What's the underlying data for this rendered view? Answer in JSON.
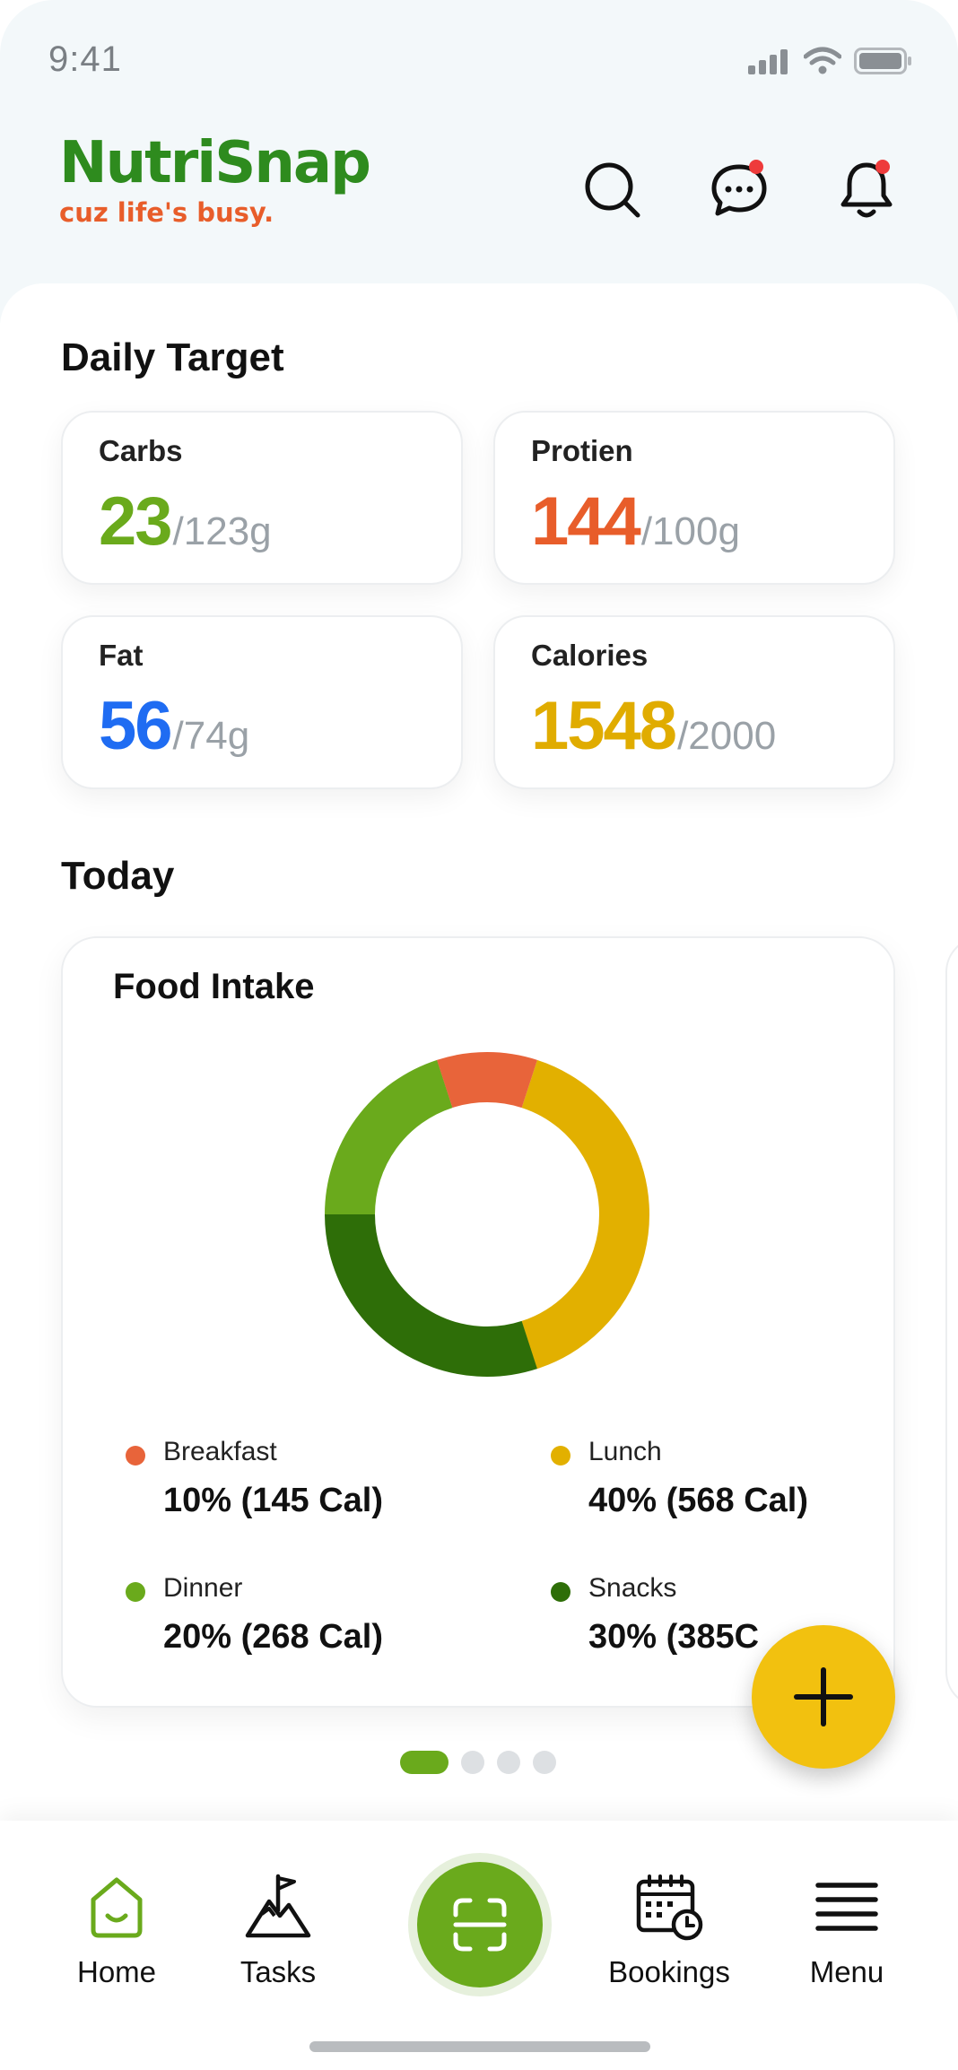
{
  "status_bar": {
    "time": "9:41"
  },
  "brand": {
    "name": "NutriSnap",
    "tagline": "cuz life's busy."
  },
  "header_icons": [
    "search-icon",
    "chat-icon",
    "bell-icon"
  ],
  "daily_target": {
    "title": "Daily Target",
    "items": [
      {
        "label": "Carbs",
        "value": "23",
        "target": "/123g",
        "color": "#6aaa1c"
      },
      {
        "label": "Protien",
        "value": "144",
        "target": "/100g",
        "color": "#e85d2a"
      },
      {
        "label": "Fat",
        "value": "56",
        "target": "/74g",
        "color": "#1f6cf2"
      },
      {
        "label": "Calories",
        "value": "1548",
        "target": "/2000",
        "color": "#e0ac00"
      }
    ]
  },
  "today": {
    "title": "Today",
    "food_intake": {
      "title": "Food Intake",
      "legend": [
        {
          "name": "Breakfast",
          "value": "10% (145 Cal)",
          "color": "#e8643a"
        },
        {
          "name": "Lunch",
          "value": "40% (568 Cal)",
          "color": "#e2b000"
        },
        {
          "name": "Dinner",
          "value": "20% (268 Cal)",
          "color": "#6aaa1c"
        },
        {
          "name": "Snacks",
          "value": "30% (385C",
          "color": "#2e6e08"
        }
      ]
    },
    "pagination": {
      "total": 4,
      "active": 1
    }
  },
  "fab": {
    "icon": "plus-icon"
  },
  "bottom_nav": {
    "home": "Home",
    "tasks": "Tasks",
    "scan_icon": "scan-icon",
    "bookings": "Bookings",
    "menu": "Menu"
  },
  "chart_data": {
    "type": "pie",
    "categories": [
      "Breakfast",
      "Lunch",
      "Dinner",
      "Snacks"
    ],
    "values": [
      10,
      40,
      20,
      30
    ],
    "title": "Food Intake",
    "colors": [
      "#e8643a",
      "#e2b000",
      "#6aaa1c",
      "#2e6e08"
    ]
  }
}
